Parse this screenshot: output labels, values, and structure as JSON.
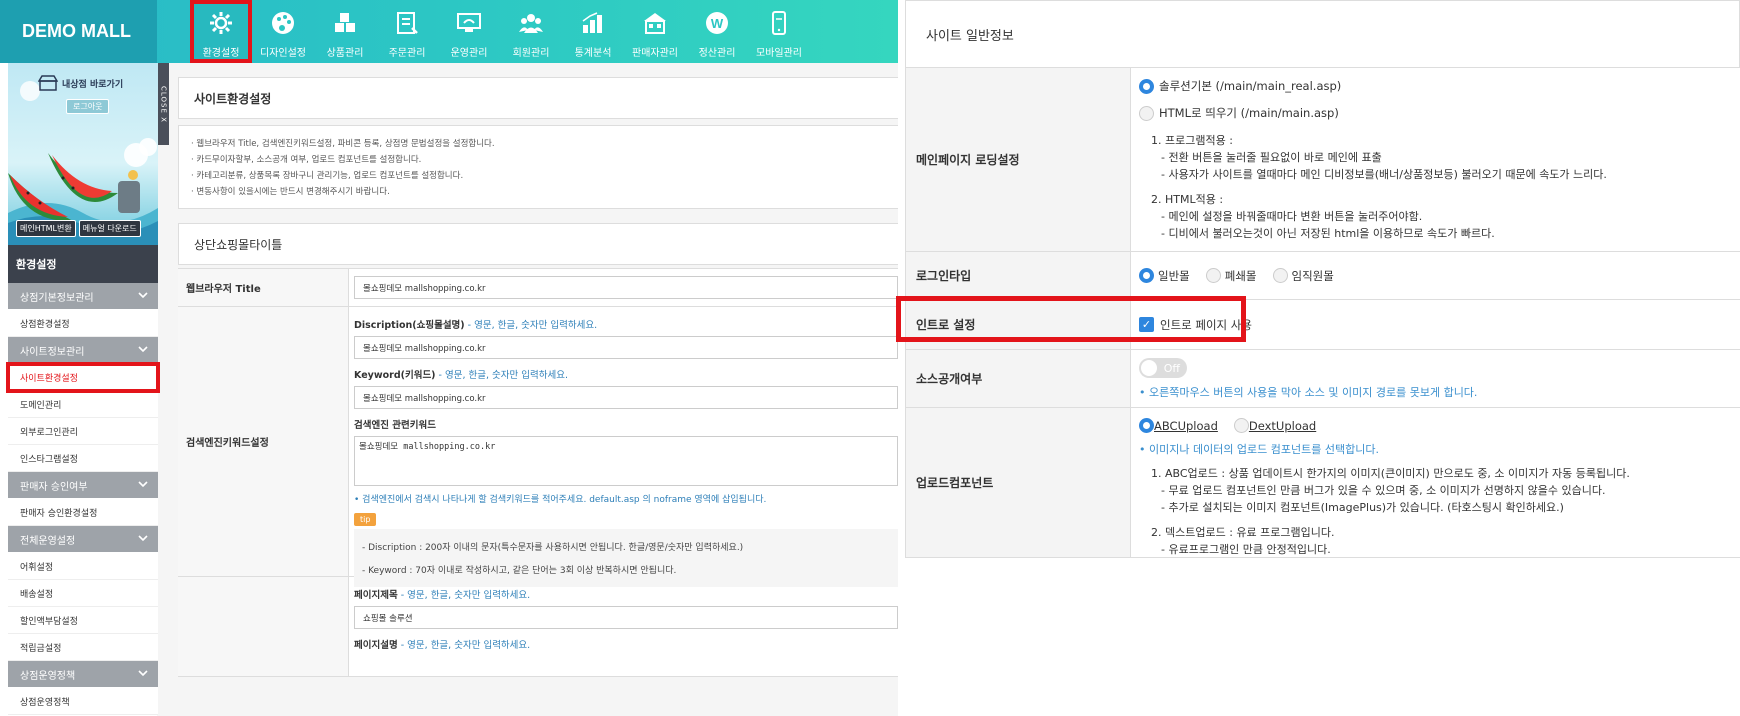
{
  "left": {
    "logo": "DEMO MALL",
    "topmenu": [
      {
        "label": "환경설정",
        "icon": "gear-icon"
      },
      {
        "label": "디자인설정",
        "icon": "palette-icon"
      },
      {
        "label": "상품관리",
        "icon": "boxes-icon"
      },
      {
        "label": "주문관리",
        "icon": "order-icon"
      },
      {
        "label": "운영관리",
        "icon": "monitor-icon"
      },
      {
        "label": "회원관리",
        "icon": "members-icon"
      },
      {
        "label": "통계분석",
        "icon": "stats-icon"
      },
      {
        "label": "판매자관리",
        "icon": "store-icon"
      },
      {
        "label": "정산관리",
        "icon": "coin-icon"
      },
      {
        "label": "모바일관리",
        "icon": "mobile-icon"
      }
    ],
    "banner": {
      "shop_link": "내상점 바로가기",
      "logout": "로그아웃",
      "btn_html": "메인HTML변환",
      "btn_manual": "메뉴얼 다운로드",
      "close": "CLOSE X"
    },
    "nav_title": "환경설정",
    "nav": [
      {
        "type": "group",
        "label": "상점기본정보관리"
      },
      {
        "type": "item",
        "label": "상점환경설정"
      },
      {
        "type": "group",
        "label": "사이트정보관리"
      },
      {
        "type": "item",
        "label": "사이트환경설정",
        "active": true
      },
      {
        "type": "item",
        "label": "도메인관리"
      },
      {
        "type": "item",
        "label": "외부로그인관리"
      },
      {
        "type": "item",
        "label": "인스타그램설정"
      },
      {
        "type": "group",
        "label": "판매자 승인여부"
      },
      {
        "type": "item",
        "label": "판매자 승인환경설정"
      },
      {
        "type": "group",
        "label": "전체운영설정"
      },
      {
        "type": "item",
        "label": "어휘설정"
      },
      {
        "type": "item",
        "label": "배송설정"
      },
      {
        "type": "item",
        "label": "할인액부담설정"
      },
      {
        "type": "item",
        "label": "적립금설정"
      },
      {
        "type": "group",
        "label": "상점운영정책"
      },
      {
        "type": "item",
        "label": "상점운영정책"
      }
    ],
    "page_title": "사이트환경설정",
    "notes": [
      "· 웹브라우저 Title, 검색엔진키워드설정, 파비콘 등록, 상점명 문법설정을 설정합니다.",
      "· 카드무이자할부, 소스공개 여부, 업로드 컴포넌트를 설정합니다.",
      "· 카테고리분류, 상품목록 장바구니 관리기능, 업로드 컴포넌트를 설정합니다.",
      "· 변동사항이 있을시에는 반드시 변경해주시기 바랍니다."
    ],
    "section_title": "상단쇼핑몰타이틀",
    "browser_title_label": "웹브라우저 Title",
    "browser_title_value": "몰쇼핑데모 mallshopping.co.kr",
    "seo_label": "검색엔진키워드설정",
    "desc_title": "Discription(쇼핑몰설명)",
    "desc_hint": " - 영문, 한글, 숫자만 입력하세요.",
    "desc_value": "몰쇼핑데모 mallshopping.co.kr",
    "kw_title": "Keyword(키워드)",
    "kw_hint": " - 영문, 한글, 숫자만 입력하세요.",
    "kw_value": "몰쇼핑데모 mallshopping.co.kr",
    "seo_kw_title": "검색엔진 관련키워드",
    "seo_kw_value": "몰쇼핑데모 mallshopping.co.kr",
    "seo_hint": "• 검색엔진에서 검색시 나타나게 할 검색키워드를 적어주세요. default.asp 의 noframe 영역에 삽입됩니다.",
    "tip": "tip",
    "tip_lines": [
      "- Discription : 200자 이내의 문자(특수문자를 사용하시면 안됩니다. 한글/영문/숫자만 입력하세요.)",
      "- Keyword : 70자 이내로 작성하시고, 같은 단어는 3회 이상 반복하시면 안됩니다."
    ],
    "page_subject_title": "페이지제목",
    "page_subject_hint": " - 영문, 한글, 숫자만 입력하세요.",
    "page_subject_value": "쇼핑몰 솔루션",
    "page_desc_title": "페이지설명",
    "page_desc_hint": " - 영문, 한글, 숫자만 입력하세요."
  },
  "right": {
    "header": "사이트 일반정보",
    "main_loading": {
      "label": "메인페이지 로딩설정",
      "opt1": "솔루션기본 (/main/main_real.asp)",
      "opt2": "HTML로 띄우기 (/main/main.asp)",
      "l1": "1. 프로그램적용 :",
      "l1a": "- 전환 버튼을 눌러줄 필요없이 바로 메인에 표출",
      "l1b": "- 사용자가 사이트를 열때마다 메인 디비정보를(배너/상품정보등) 불러오기 때문에 속도가 느리다.",
      "l2": "2. HTML적용 :",
      "l2a": "- 메인에 설정을 바꿔줄때마다 변환 버튼을 눌러주어야함.",
      "l2b": "- 디비에서 불러오는것이 아닌 저장된 html을 이용하므로 속도가 빠르다."
    },
    "login_type": {
      "label": "로그인타입",
      "opts": [
        "일반몰",
        "폐쇄몰",
        "임직원몰"
      ]
    },
    "intro": {
      "label": "인트로 설정",
      "checkbox": "인트로 페이지 사용"
    },
    "source": {
      "label": "소스공개여부",
      "toggle": "Off",
      "hint": "• 오른쪽마우스 버튼의 사용을 막아 소스 및 이미지 경로를 못보게 합니다."
    },
    "upload": {
      "label": "업로드컴포넌트",
      "opt1": "ABCUpload",
      "opt2": "DextUpload",
      "hint": "• 이미지나 데이터의 업로드 컴포넌트를 선택합니다.",
      "l1": "1. ABC업로드 : 상품 업데이트시 한가지의 이미지(큰이미지) 만으로도 중, 소 이미지가 자동 등록됩니다.",
      "l1a": "- 무료 업로드 컴포넌트인 만큼 버그가 있을 수 있으며 중, 소 이미지가 선명하지 않을수 있습니다.",
      "l1b": "- 추가로 설치되는 이미지 컴포넌트(ImagePlus)가 있습니다. (타호스팅시 확인하세요.)",
      "l2": "2. 덱스트업로드 : 유료 프로그램입니다.",
      "l2a": "- 유료프로그램인 만큼 안정적입니다."
    }
  }
}
